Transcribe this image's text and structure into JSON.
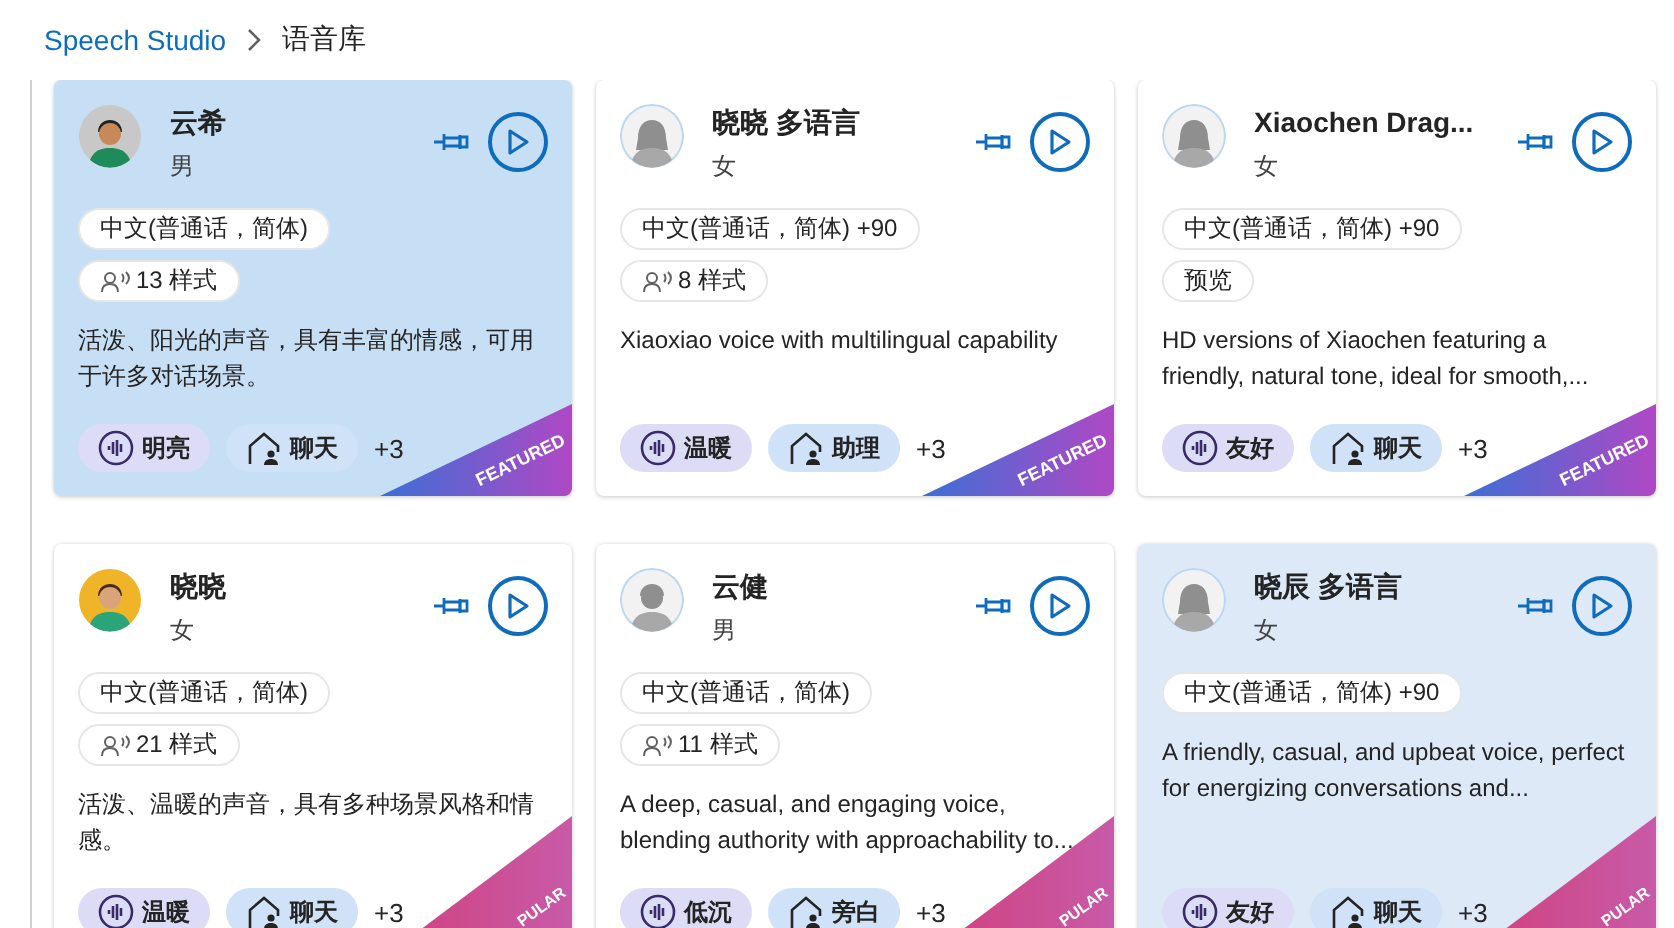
{
  "breadcrumb": [
    {
      "label": "Speech Studio",
      "kind": "link"
    },
    {
      "label": "语音库",
      "kind": "current"
    }
  ],
  "voices": [
    {
      "name": "云希",
      "gender": "男",
      "avatar": {
        "kind": "cartoon-male"
      },
      "selected": true,
      "hovered": false,
      "chips": [
        {
          "kind": "locale",
          "label": "中文(普通话，简体)"
        },
        {
          "kind": "styles",
          "label": "13 样式"
        }
      ],
      "description": "活泼、阳光的声音，具有丰富的情感，可用于许多对话场景。",
      "tags": [
        {
          "kind": "tone",
          "label": "明亮"
        },
        {
          "kind": "scenario",
          "label": "聊天"
        }
      ],
      "more": "+3",
      "ribbon": {
        "kind": "featured",
        "label": "FEATURED"
      }
    },
    {
      "name": "晓晓 多语言",
      "gender": "女",
      "avatar": {
        "kind": "silhouette-female"
      },
      "selected": false,
      "hovered": false,
      "chips": [
        {
          "kind": "locale",
          "label": "中文(普通话，简体) +90"
        },
        {
          "kind": "styles",
          "label": "8 样式"
        }
      ],
      "description": "Xiaoxiao voice with multilingual capability",
      "tags": [
        {
          "kind": "tone",
          "label": "温暖"
        },
        {
          "kind": "scenario",
          "label": "助理"
        }
      ],
      "more": "+3",
      "ribbon": {
        "kind": "featured",
        "label": "FEATURED"
      }
    },
    {
      "name": "Xiaochen Drag...",
      "gender": "女",
      "avatar": {
        "kind": "silhouette-female"
      },
      "selected": false,
      "hovered": false,
      "chips": [
        {
          "kind": "locale",
          "label": "中文(普通话，简体) +90"
        },
        {
          "kind": "preview",
          "label": "预览"
        }
      ],
      "description": "HD versions of Xiaochen featuring a friendly, natural tone, ideal for smooth,...",
      "tags": [
        {
          "kind": "tone",
          "label": "友好"
        },
        {
          "kind": "scenario",
          "label": "聊天"
        }
      ],
      "more": "+3",
      "ribbon": {
        "kind": "featured",
        "label": "FEATURED"
      }
    },
    {
      "name": "晓晓",
      "gender": "女",
      "avatar": {
        "kind": "cartoon-female"
      },
      "selected": false,
      "hovered": false,
      "chips": [
        {
          "kind": "locale",
          "label": "中文(普通话，简体)"
        },
        {
          "kind": "styles",
          "label": "21 样式"
        }
      ],
      "description": "活泼、温暖的声音，具有多种场景风格和情感。",
      "tags": [
        {
          "kind": "tone",
          "label": "温暖"
        },
        {
          "kind": "scenario",
          "label": "聊天"
        }
      ],
      "more": "+3",
      "ribbon": {
        "kind": "popular",
        "label": "PULAR"
      }
    },
    {
      "name": "云健",
      "gender": "男",
      "avatar": {
        "kind": "silhouette-male"
      },
      "selected": false,
      "hovered": false,
      "chips": [
        {
          "kind": "locale",
          "label": "中文(普通话，简体)"
        },
        {
          "kind": "styles",
          "label": "11 样式"
        }
      ],
      "description": "A deep, casual, and engaging voice, blending authority with approachability to...",
      "tags": [
        {
          "kind": "tone",
          "label": "低沉"
        },
        {
          "kind": "scenario",
          "label": "旁白"
        }
      ],
      "more": "+3",
      "ribbon": {
        "kind": "popular",
        "label": "PULAR"
      }
    },
    {
      "name": "晓辰 多语言",
      "gender": "女",
      "avatar": {
        "kind": "silhouette-female"
      },
      "selected": false,
      "hovered": true,
      "chips": [
        {
          "kind": "locale",
          "label": "中文(普通话，简体) +90"
        }
      ],
      "description": "A friendly, casual, and upbeat voice, perfect for energizing conversations and...",
      "tags": [
        {
          "kind": "tone",
          "label": "友好"
        },
        {
          "kind": "scenario",
          "label": "聊天"
        }
      ],
      "more": "+3",
      "ribbon": {
        "kind": "popular",
        "label": "PULAR"
      }
    }
  ]
}
